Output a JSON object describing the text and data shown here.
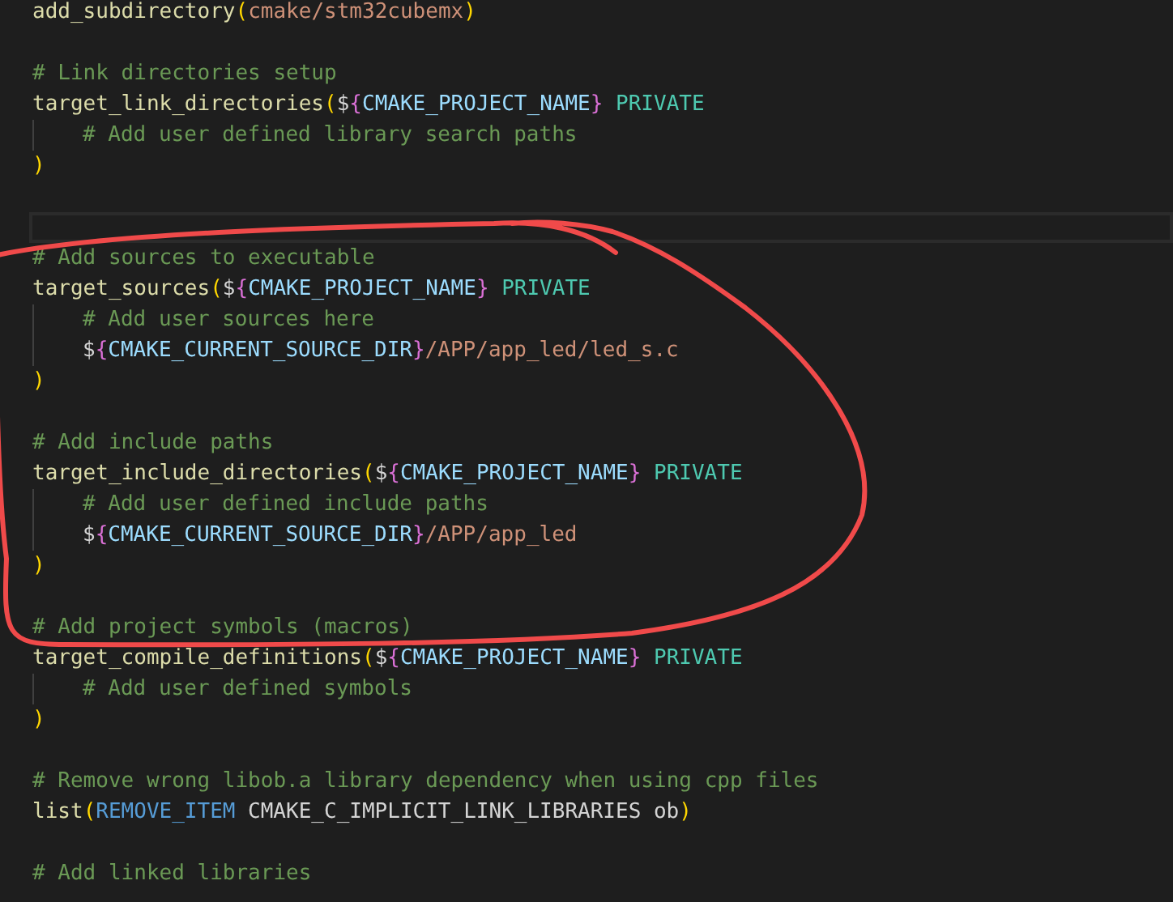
{
  "lines": [
    {
      "kind": "code",
      "tokens": [
        {
          "kind": "function",
          "text": "add_subdirectory"
        },
        {
          "kind": "paren",
          "text": "("
        },
        {
          "kind": "string",
          "text": "cmake/stm32cubemx"
        },
        {
          "kind": "paren",
          "text": ")"
        }
      ]
    },
    {
      "kind": "blank"
    },
    {
      "kind": "code",
      "tokens": [
        {
          "kind": "comment",
          "text": "# Link directories setup"
        }
      ]
    },
    {
      "kind": "code",
      "tokens": [
        {
          "kind": "function",
          "text": "target_link_directories"
        },
        {
          "kind": "paren",
          "text": "("
        },
        {
          "kind": "plain",
          "text": "$"
        },
        {
          "kind": "brace",
          "text": "{"
        },
        {
          "kind": "variable",
          "text": "CMAKE_PROJECT_NAME"
        },
        {
          "kind": "brace",
          "text": "}"
        },
        {
          "kind": "keyword",
          "text": "PRIVATE"
        }
      ]
    },
    {
      "kind": "code",
      "indented": true,
      "tokens": [
        {
          "kind": "comment",
          "text": "# Add user defined library search paths"
        }
      ]
    },
    {
      "kind": "code",
      "tokens": [
        {
          "kind": "paren",
          "text": ")"
        }
      ]
    },
    {
      "kind": "blank"
    },
    {
      "kind": "blank",
      "current": true
    },
    {
      "kind": "code",
      "tokens": [
        {
          "kind": "comment",
          "text": "# Add sources to executable"
        }
      ]
    },
    {
      "kind": "code",
      "tokens": [
        {
          "kind": "function",
          "text": "target_sources"
        },
        {
          "kind": "paren",
          "text": "("
        },
        {
          "kind": "plain",
          "text": "$"
        },
        {
          "kind": "brace",
          "text": "{"
        },
        {
          "kind": "variable",
          "text": "CMAKE_PROJECT_NAME"
        },
        {
          "kind": "brace",
          "text": "}"
        },
        {
          "kind": "keyword",
          "text": "PRIVATE"
        }
      ]
    },
    {
      "kind": "code",
      "indented": true,
      "tokens": [
        {
          "kind": "comment",
          "text": "# Add user sources here"
        }
      ]
    },
    {
      "kind": "code",
      "indented": true,
      "tokens": [
        {
          "kind": "plain",
          "text": "$"
        },
        {
          "kind": "brace",
          "text": "{"
        },
        {
          "kind": "variable",
          "text": "CMAKE_CURRENT_SOURCE_DIR"
        },
        {
          "kind": "brace",
          "text": "}"
        },
        {
          "kind": "string",
          "text": "/APP/app_led/led_s.c"
        }
      ]
    },
    {
      "kind": "code",
      "tokens": [
        {
          "kind": "paren",
          "text": ")"
        }
      ]
    },
    {
      "kind": "blank"
    },
    {
      "kind": "code",
      "tokens": [
        {
          "kind": "comment",
          "text": "# Add include paths"
        }
      ]
    },
    {
      "kind": "code",
      "tokens": [
        {
          "kind": "function",
          "text": "target_include_directories"
        },
        {
          "kind": "paren",
          "text": "("
        },
        {
          "kind": "plain",
          "text": "$"
        },
        {
          "kind": "brace",
          "text": "{"
        },
        {
          "kind": "variable",
          "text": "CMAKE_PROJECT_NAME"
        },
        {
          "kind": "brace",
          "text": "}"
        },
        {
          "kind": "keyword",
          "text": "PRIVATE"
        }
      ]
    },
    {
      "kind": "code",
      "indented": true,
      "tokens": [
        {
          "kind": "comment",
          "text": "# Add user defined include paths"
        }
      ]
    },
    {
      "kind": "code",
      "indented": true,
      "tokens": [
        {
          "kind": "plain",
          "text": "$"
        },
        {
          "kind": "brace",
          "text": "{"
        },
        {
          "kind": "variable",
          "text": "CMAKE_CURRENT_SOURCE_DIR"
        },
        {
          "kind": "brace",
          "text": "}"
        },
        {
          "kind": "string",
          "text": "/APP/app_led"
        }
      ]
    },
    {
      "kind": "code",
      "tokens": [
        {
          "kind": "paren",
          "text": ")"
        }
      ]
    },
    {
      "kind": "blank"
    },
    {
      "kind": "code",
      "tokens": [
        {
          "kind": "comment",
          "text": "# Add project symbols (macros)"
        }
      ]
    },
    {
      "kind": "code",
      "tokens": [
        {
          "kind": "function",
          "text": "target_compile_definitions"
        },
        {
          "kind": "paren",
          "text": "("
        },
        {
          "kind": "plain",
          "text": "$"
        },
        {
          "kind": "brace",
          "text": "{"
        },
        {
          "kind": "variable",
          "text": "CMAKE_PROJECT_NAME"
        },
        {
          "kind": "brace",
          "text": "}"
        },
        {
          "kind": "keyword",
          "text": "PRIVATE"
        }
      ]
    },
    {
      "kind": "code",
      "indented": true,
      "tokens": [
        {
          "kind": "comment",
          "text": "# Add user defined symbols"
        }
      ]
    },
    {
      "kind": "code",
      "tokens": [
        {
          "kind": "paren",
          "text": ")"
        }
      ]
    },
    {
      "kind": "blank"
    },
    {
      "kind": "code",
      "tokens": [
        {
          "kind": "comment",
          "text": "# Remove wrong libob.a library dependency when using cpp files"
        }
      ]
    },
    {
      "kind": "code",
      "tokens": [
        {
          "kind": "function",
          "text": "list"
        },
        {
          "kind": "paren",
          "text": "("
        },
        {
          "kind": "builtin",
          "text": "REMOVE_ITEM"
        },
        {
          "kind": "plain",
          "text": "CMAKE_C_IMPLICIT_LINK_LIBRARIES ob"
        },
        {
          "kind": "paren",
          "text": ")"
        }
      ]
    },
    {
      "kind": "blank"
    },
    {
      "kind": "code",
      "tokens": [
        {
          "kind": "comment",
          "text": "# Add linked libraries"
        }
      ]
    }
  ]
}
